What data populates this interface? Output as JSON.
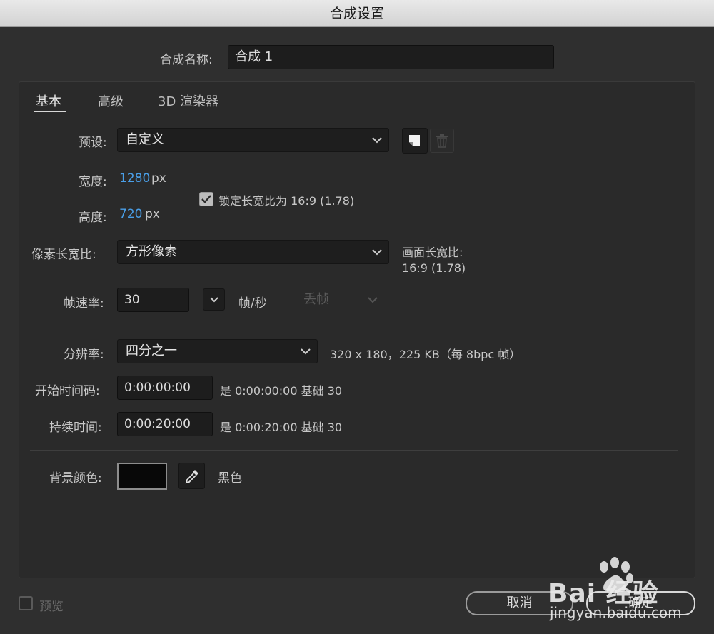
{
  "window": {
    "title": "合成设置"
  },
  "comp_name": {
    "label": "合成名称:",
    "value": "合成 1"
  },
  "tabs": [
    {
      "label": "基本"
    },
    {
      "label": "高级"
    },
    {
      "label": "3D 渲染器"
    }
  ],
  "preset": {
    "label": "预设:",
    "value": "自定义",
    "save_icon": "save-preset-icon",
    "delete_icon": "trash-icon"
  },
  "width": {
    "label": "宽度:",
    "value": "1280",
    "unit": "px"
  },
  "height": {
    "label": "高度:",
    "value": "720",
    "unit": "px"
  },
  "lock_aspect": {
    "label": "锁定长宽比为 16:9 (1.78)",
    "checked": true
  },
  "pixel_aspect": {
    "label": "像素长宽比:",
    "value": "方形像素"
  },
  "frame_aspect": {
    "label": "画面长宽比:",
    "value": "16:9 (1.78)"
  },
  "frame_rate": {
    "label": "帧速率:",
    "value": "30",
    "unit": "帧/秒",
    "drop_frame": "丢帧"
  },
  "resolution": {
    "label": "分辨率:",
    "value": "四分之一",
    "info": "320 x 180，225 KB（每 8bpc 帧）"
  },
  "start_timecode": {
    "label": "开始时间码:",
    "value": "0:00:00:00",
    "info": "是 0:00:00:00  基础 30"
  },
  "duration": {
    "label": "持续时间:",
    "value": "0:00:20:00",
    "info": "是 0:00:20:00  基础 30"
  },
  "background": {
    "label": "背景颜色:",
    "color": "#080808",
    "name": "黑色",
    "eyedropper_icon": "eyedropper-icon"
  },
  "preview": {
    "label": "预览",
    "checked": false
  },
  "buttons": {
    "cancel": "取消",
    "ok": "确定"
  },
  "watermark": {
    "brand": "Bai 经验",
    "url": "jingyan.baidu.com"
  },
  "colors": {
    "accent_blue": "#4a9fe8",
    "dialog_bg": "#2f2f2f",
    "field_bg": "#1d1d1d"
  }
}
